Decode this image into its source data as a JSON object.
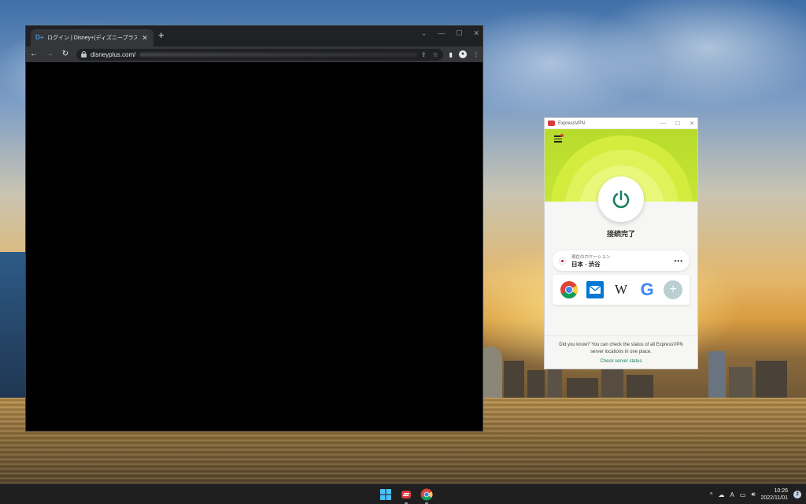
{
  "browser": {
    "tab": {
      "title": "ログイン | Disney+(ディズニープラス)",
      "close_glyph": "✕"
    },
    "new_tab_glyph": "+",
    "address": {
      "url": "disneyplus.com/"
    },
    "nav": {
      "back_glyph": "←",
      "forward_glyph": "→",
      "reload_glyph": "↻"
    },
    "window_controls": {
      "collapse_glyph": "⌄",
      "minimize_glyph": "—",
      "maximize_glyph": "☐",
      "close_glyph": "✕"
    },
    "toolbar_icons": {
      "share_glyph": "⇪",
      "bookmark_glyph": "☆",
      "sidepanel_glyph": "▮",
      "menu_glyph": "⋮"
    }
  },
  "vpn": {
    "app_title": "ExpressVPN",
    "window_controls": {
      "minimize_glyph": "—",
      "maximize_glyph": "☐",
      "close_glyph": "✕"
    },
    "status": "接続完了",
    "location": {
      "label": "現在のロケーション",
      "name": "日本 - 渋谷",
      "more_glyph": "•••"
    },
    "shortcuts": [
      {
        "name": "chrome",
        "icon": "chrome-icon"
      },
      {
        "name": "mail",
        "icon": "mail-icon"
      },
      {
        "name": "wikipedia",
        "icon": "wikipedia-icon",
        "glyph": "W"
      },
      {
        "name": "google",
        "icon": "google-icon",
        "glyph": "G"
      },
      {
        "name": "add",
        "icon": "plus-circle-icon",
        "glyph": "+"
      }
    ],
    "tip": "Did you know? You can check the status of all ExpressVPN server locations in one place.",
    "link": "Check server status",
    "accent_color": "#c7e437",
    "brand_color": "#da3940",
    "power_color": "#1a7f63"
  },
  "taskbar": {
    "tray": {
      "chevron_glyph": "^",
      "ime_glyph": "A"
    },
    "clock": {
      "time": "10:26",
      "date": "2022/11/01"
    },
    "notification_count": "2"
  }
}
